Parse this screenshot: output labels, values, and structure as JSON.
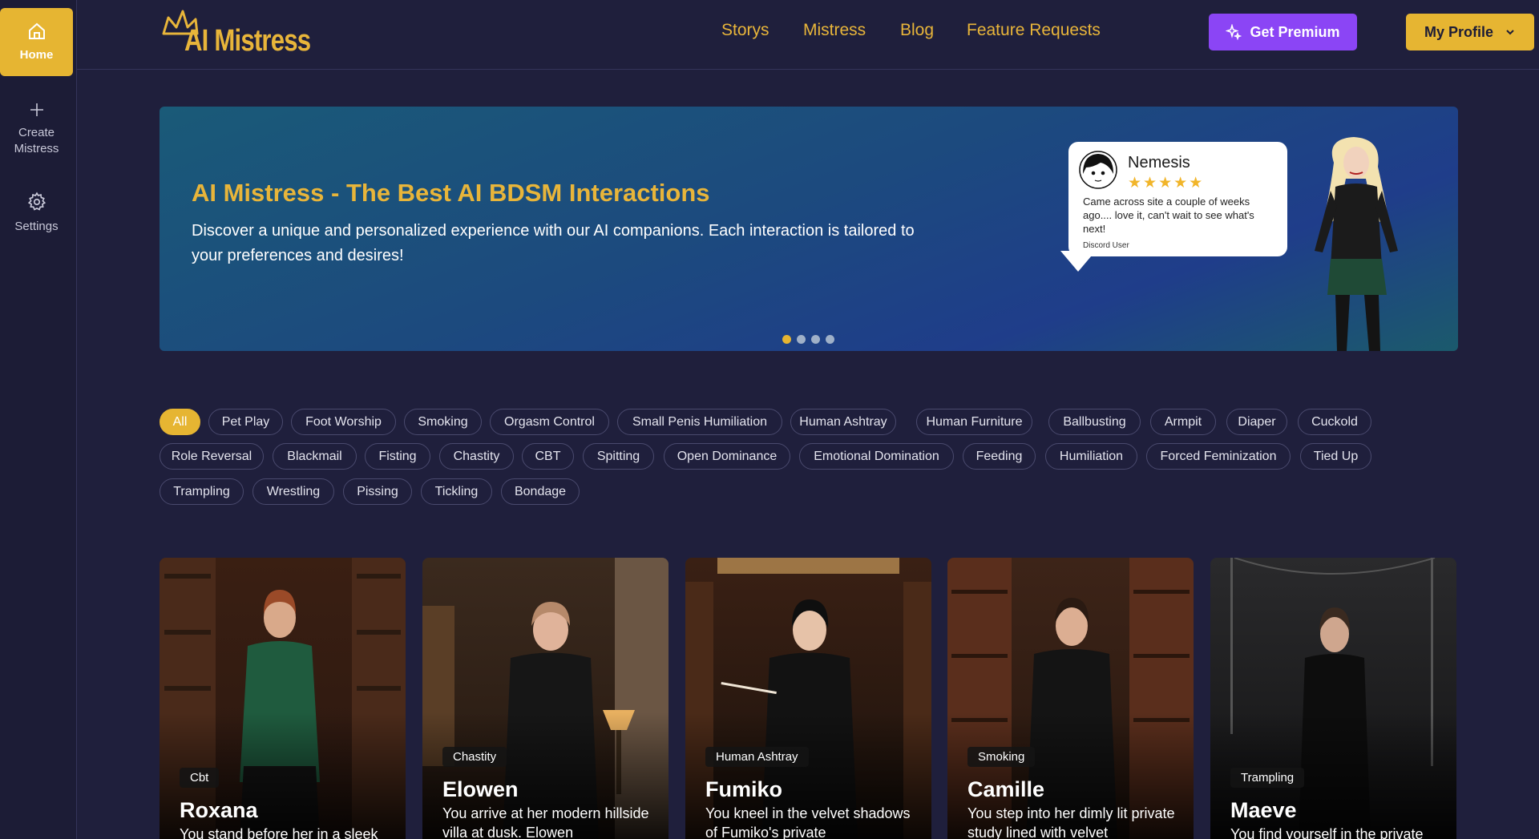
{
  "sidebar": {
    "items": [
      {
        "label": "Home",
        "icon": "home-icon"
      },
      {
        "label": "Create Mistress",
        "icon": "plus-icon"
      },
      {
        "label": "Settings",
        "icon": "gear-icon"
      }
    ]
  },
  "header": {
    "logo_text": "AI Mistress",
    "nav": [
      "Storys",
      "Mistress",
      "Blog",
      "Feature Requests"
    ],
    "premium_label": "Get Premium",
    "profile_label": "My Profile"
  },
  "banner": {
    "title": "AI Mistress - The Best AI BDSM Interactions",
    "description": "Discover a unique and personalized experience with our AI companions. Each interaction is tailored to your preferences and desires!",
    "review": {
      "name": "Nemesis",
      "stars": "★★★★★",
      "rating": 5,
      "text": "Came across site a couple of weeks ago.... love it, can't wait to see what's next!",
      "user": "Discord User"
    },
    "slides_count": 4,
    "active_slide": 1
  },
  "tags": [
    "All",
    "Pet Play",
    "Foot Worship",
    "Smoking",
    "Orgasm Control",
    "Small Penis Humiliation",
    "Human Ashtray",
    "Human Furniture",
    "Ballbusting",
    "Armpit",
    "Diaper",
    "Cuckold",
    "Role Reversal",
    "Blackmail",
    "Fisting",
    "Chastity",
    "CBT",
    "Spitting",
    "Open Dominance",
    "Emotional Domination",
    "Feeding",
    "Humiliation",
    "Forced Feminization",
    "Tied Up",
    "Trampling",
    "Wrestling",
    "Pissing",
    "Tickling",
    "Bondage"
  ],
  "active_tag": "All",
  "cards": [
    {
      "name": "Roxana",
      "badge": "Cbt",
      "desc": "You stand before her in a sleek"
    },
    {
      "name": "Elowen",
      "badge": "Chastity",
      "desc": "You arrive at her modern hillside villa at dusk. Elowen"
    },
    {
      "name": "Fumiko",
      "badge": "Human Ashtray",
      "desc": "You kneel in the velvet shadows of Fumiko's private"
    },
    {
      "name": "Camille",
      "badge": "Smoking",
      "desc": "You step into her dimly lit private study lined with velvet"
    },
    {
      "name": "Maeve",
      "badge": "Trampling",
      "desc": "You find yourself in the private"
    }
  ],
  "colors": {
    "accent": "#e6b532",
    "premium": "#8b45f5",
    "background": "#1f1f3c"
  }
}
